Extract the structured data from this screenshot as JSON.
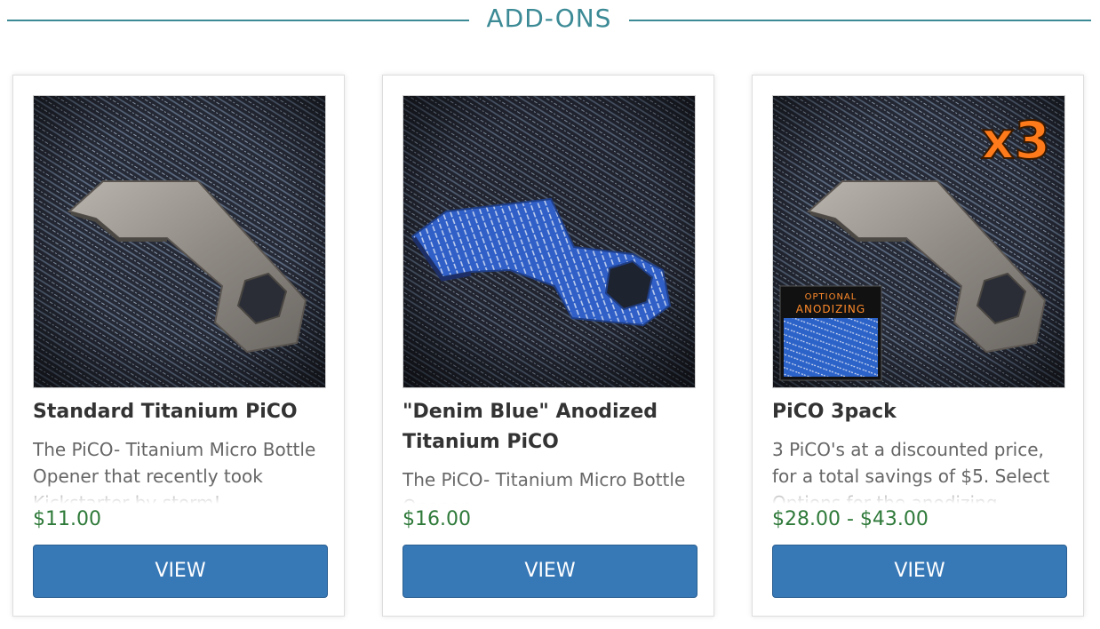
{
  "section": {
    "title": "ADD-ONS"
  },
  "products": [
    {
      "title": "Standard Titanium PiCO",
      "description": "The PiCO- Titanium Micro Bottle Opener that recently took Kickstarter by storm!",
      "price": "$11.00",
      "button": "VIEW",
      "image": {
        "subject": "titanium-bottle-opener",
        "finish": "raw titanium"
      }
    },
    {
      "title": "\"Denim Blue\" Anodized Titanium PiCO",
      "description": "The PiCO- Titanium Micro Bottle Opener",
      "price": "$16.00",
      "button": "VIEW",
      "image": {
        "subject": "titanium-bottle-opener",
        "finish": "denim blue anodized"
      }
    },
    {
      "title": "PiCO 3pack",
      "description": "3 PiCO's at a discounted price, for a total savings of $5. Select Options for the anodizing",
      "price": "$28.00 - $43.00",
      "button": "VIEW",
      "image": {
        "subject": "titanium-bottle-opener",
        "badge": "x3",
        "inset_line1": "OPTIONAL",
        "inset_line2": "ANODIZING"
      }
    }
  ],
  "colors": {
    "accent": "#3b8a95",
    "price": "#2f7a3a",
    "button": "#3778b7",
    "badge": "#ff7a1a"
  }
}
